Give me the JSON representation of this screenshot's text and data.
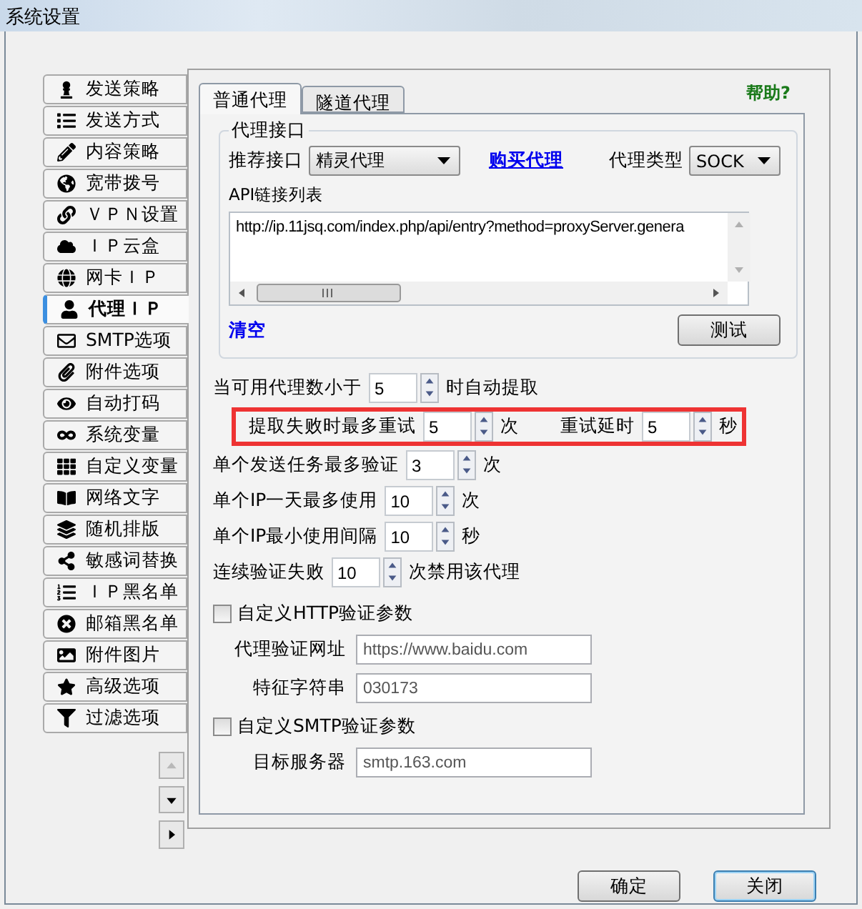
{
  "window": {
    "title": "系统设置"
  },
  "sidebar": {
    "items": [
      {
        "label": "发送策略",
        "selected": false
      },
      {
        "label": "发送方式",
        "selected": false
      },
      {
        "label": "内容策略",
        "selected": false
      },
      {
        "label": "宽带拨号",
        "selected": false
      },
      {
        "label": "ＶＰＮ设置",
        "selected": false
      },
      {
        "label": "ＩＰ云盒",
        "selected": false
      },
      {
        "label": "网卡ＩＰ",
        "selected": false
      },
      {
        "label": "代理ＩＰ",
        "selected": true
      },
      {
        "label": "SMTP选项",
        "selected": false
      },
      {
        "label": "附件选项",
        "selected": false
      },
      {
        "label": "自动打码",
        "selected": false
      },
      {
        "label": "系统变量",
        "selected": false
      },
      {
        "label": "自定义变量",
        "selected": false
      },
      {
        "label": "网络文字",
        "selected": false
      },
      {
        "label": "随机排版",
        "selected": false
      },
      {
        "label": "敏感词替换",
        "selected": false
      },
      {
        "label": "ＩＰ黑名单",
        "selected": false
      },
      {
        "label": "邮箱黑名单",
        "selected": false
      },
      {
        "label": "附件图片",
        "selected": false
      },
      {
        "label": "高级选项",
        "selected": false
      },
      {
        "label": "过滤选项",
        "selected": false
      }
    ]
  },
  "sidebar_scroll": [
    {
      "kind": "up",
      "disabled": true
    },
    {
      "kind": "down",
      "disabled": false
    },
    {
      "kind": "right",
      "disabled": false
    }
  ],
  "tabs": [
    {
      "label": "普通代理",
      "selected": true
    },
    {
      "label": "隧道代理",
      "selected": false
    }
  ],
  "help_link": "帮助?",
  "proxy_group": {
    "title": "代理接口",
    "recommend_label": "推荐接口",
    "recommend_value": "精灵代理",
    "buy_link": "购买代理",
    "type_label": "代理类型",
    "type_value": "SOCK",
    "api_label": "API链接列表",
    "api_text": "http://ip.11jsq.com/index.php/api/entry?method=proxyServer.genera",
    "clear_link": "清空",
    "test_button": "测试"
  },
  "settings": [
    {
      "highlighted": false,
      "parts": [
        {
          "kind": "text",
          "text": "当可用代理数小于"
        },
        {
          "kind": "spin",
          "value": "5"
        },
        {
          "kind": "text",
          "text": "时自动提取"
        }
      ]
    },
    {
      "highlighted": true,
      "parts": [
        {
          "kind": "text",
          "text": "提取失败时最多重试"
        },
        {
          "kind": "spin",
          "value": "5"
        },
        {
          "kind": "text",
          "text": "次"
        },
        {
          "kind": "text",
          "text": "重试延时"
        },
        {
          "kind": "spin",
          "value": "5"
        },
        {
          "kind": "text",
          "text": "秒"
        }
      ]
    },
    {
      "highlighted": false,
      "parts": [
        {
          "kind": "text",
          "text": "单个发送任务最多验证"
        },
        {
          "kind": "spin",
          "value": "3"
        },
        {
          "kind": "text",
          "text": "次"
        }
      ]
    },
    {
      "highlighted": false,
      "parts": [
        {
          "kind": "text",
          "text": "单个IP一天最多使用"
        },
        {
          "kind": "spin",
          "value": "10"
        },
        {
          "kind": "text",
          "text": "次"
        }
      ]
    },
    {
      "highlighted": false,
      "parts": [
        {
          "kind": "text",
          "text": "单个IP最小使用间隔"
        },
        {
          "kind": "spin",
          "value": "10"
        },
        {
          "kind": "text",
          "text": "秒"
        }
      ]
    },
    {
      "highlighted": false,
      "parts": [
        {
          "kind": "text",
          "text": "连续验证失败"
        },
        {
          "kind": "spin",
          "value": "10"
        },
        {
          "kind": "text",
          "text": "次禁用该代理"
        }
      ]
    }
  ],
  "sections": [
    {
      "label": "自定义HTTP验证参数",
      "checked": false,
      "fields": [
        {
          "label": "代理验证网址",
          "value": "https://www.baidu.com"
        },
        {
          "label": "特征字符串",
          "value": "030173"
        }
      ]
    },
    {
      "label": "自定义SMTP验证参数",
      "checked": false,
      "fields": [
        {
          "label": "目标服务器",
          "value": "smtp.163.com"
        }
      ]
    }
  ],
  "buttons": [
    {
      "label": "确定",
      "focused": false
    },
    {
      "label": "关闭",
      "focused": true
    }
  ]
}
